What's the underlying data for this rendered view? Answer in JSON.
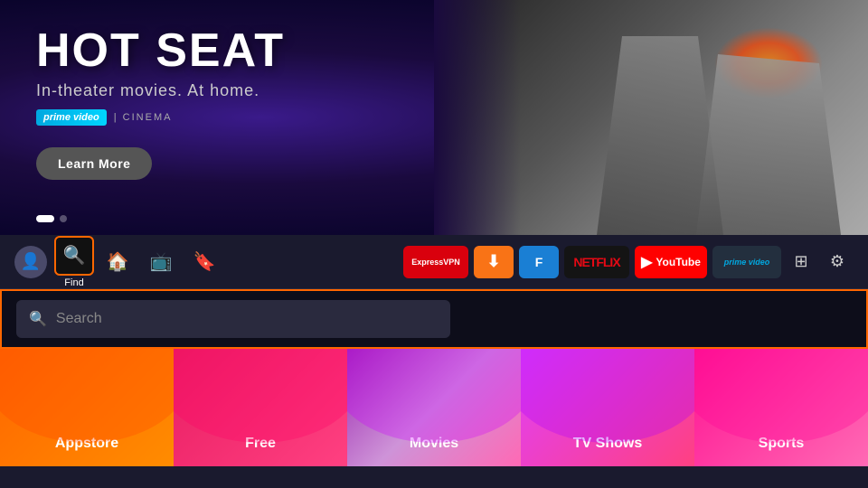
{
  "hero": {
    "title": "HOT SEAT",
    "subtitle": "In-theater movies. At home.",
    "prime_label": "prime video",
    "prime_divider": "|",
    "prime_type": "CINEMA",
    "learn_more": "Learn More",
    "dot1": "active",
    "dot2": "",
    "dot3": ""
  },
  "navbar": {
    "find_label": "Find",
    "apps": [
      {
        "id": "expressvpn",
        "label": "ExpressVPN"
      },
      {
        "id": "downloader",
        "label": "⬇"
      },
      {
        "id": "fdroid",
        "label": "🔵"
      },
      {
        "id": "netflix",
        "label": "NETFLIX"
      },
      {
        "id": "youtube",
        "label": "▶ YouTube"
      },
      {
        "id": "prime",
        "label": "prime video"
      }
    ]
  },
  "search": {
    "placeholder": "Search"
  },
  "categories": [
    {
      "id": "appstore",
      "label": "Appstore",
      "color": "#ff6600"
    },
    {
      "id": "free",
      "label": "Free",
      "color": "#e91e63"
    },
    {
      "id": "movies",
      "label": "Movies",
      "color": "#9c27b0"
    },
    {
      "id": "tvshows",
      "label": "TV Shows",
      "color": "#e040fb"
    },
    {
      "id": "sports",
      "label": "Sports",
      "color": "#ff1493"
    }
  ]
}
